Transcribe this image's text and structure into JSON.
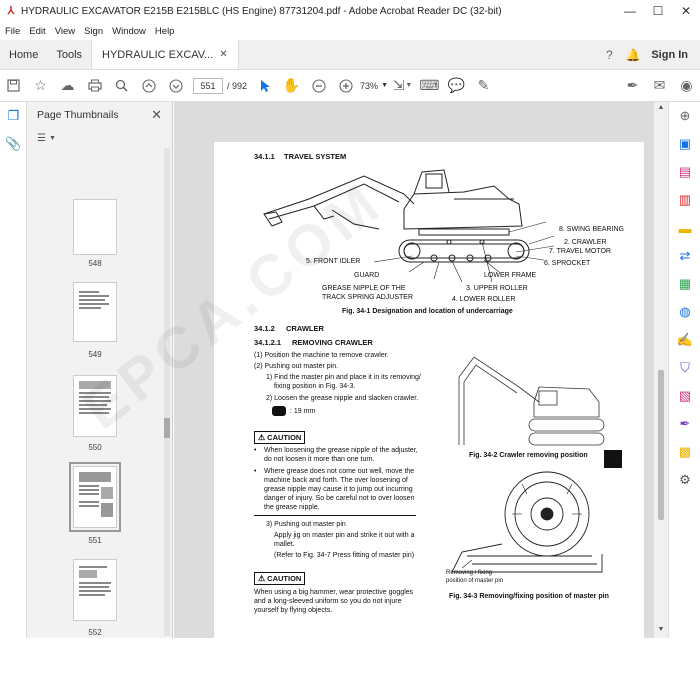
{
  "window": {
    "title": "HYDRAULIC EXCAVATOR E215B E215BLC (HS Engine) 87731204.pdf - Adobe Acrobat Reader DC (32-bit)",
    "minimize": "—",
    "maximize": "☐",
    "close": "✕"
  },
  "menu": [
    "File",
    "Edit",
    "View",
    "Sign",
    "Window",
    "Help"
  ],
  "tabs": {
    "home": "Home",
    "tools": "Tools",
    "document": "HYDRAULIC EXCAV...",
    "sign_in": "Sign In"
  },
  "toolbar": {
    "current_page": "551",
    "page_count": "/ 992",
    "zoom": "73%"
  },
  "thumbnails": {
    "title": "Page Thumbnails",
    "pages": [
      "548",
      "549",
      "550",
      "551",
      "552"
    ],
    "selected": "551"
  },
  "document": {
    "s1_num": "34.1.1",
    "s1_title": "TRAVEL SYSTEM",
    "labels": {
      "swing_bearing": "8. SWING BEARING",
      "crawler": "2. CRAWLER",
      "travel_motor": "7. TRAVEL MOTOR",
      "front_idler": "5. FRONT IDLER",
      "sprocket": "6. SPROCKET",
      "guard": "GUARD",
      "lower_frame": "LOWER FRAME",
      "grease_nipple_1": "GREASE NIPPLE OF THE",
      "grease_nipple_2": "TRACK SPRING ADJUSTER",
      "upper_roller": "3. UPPER ROLLER",
      "lower_roller": "4. LOWER ROLLER"
    },
    "fig1": "Fig. 34-1 Designation and location of undercarriage",
    "s2_num": "34.1.2",
    "s2_title": "CRAWLER",
    "s3_num": "34.1.2.1",
    "s3_title": "REMOVING CRAWLER",
    "step1": "(1)  Position the machine to remove crawler.",
    "step2": "(2)  Pushing out master pin.",
    "step2_1a": "1) Find the master pin and place it in its removing/",
    "step2_1b": "fixing position in Fig. 34-3.",
    "step2_2": "2) Loosen the grease nipple and slacken crawler.",
    "wrench": ": 19 mm",
    "caution_label": "CAUTION",
    "caution1_b1a": "When loosening the grease nipple of the adjuster,",
    "caution1_b1b": "do not loosen it more than one turn.",
    "caution1_b2a": "Where grease does not come out well, move the",
    "caution1_b2b": "machine back and forth. The over loosening of",
    "caution1_b2c": "grease nipple may cause it to jump out incurring",
    "caution1_b2d": "danger of injury. So be careful not to over loosen",
    "caution1_b2e": "the grease nipple.",
    "step2_3": "3) Pushing out master pin",
    "step2_3a": "Apply jig on master pin and strike it out with a",
    "step2_3b": "mallet.",
    "step2_3c": "(Refer to Fig. 34-7 Press fitting of master pin)",
    "caution2_a": "When using a big hammer, wear protective goggles",
    "caution2_b": "and a long-sleeved uniform so you do not injure",
    "caution2_c": "yourself by flying objects.",
    "fig2": "Fig. 34-2 Crawler removing position",
    "removing_1": "Removing / fixing",
    "removing_2": "position of master pin",
    "fig3": "Fig. 34-3 Removing/fixing position of master pin"
  }
}
